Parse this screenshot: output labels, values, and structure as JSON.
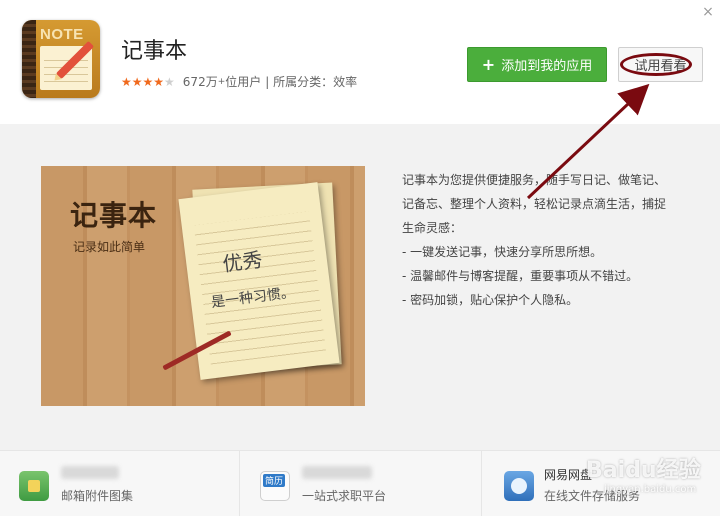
{
  "app": {
    "title": "记事本",
    "users_count": "672万",
    "users_plus": "+",
    "users_suffix": "位用户",
    "category": "| 所属分类：效率",
    "stars_on": "★★★★",
    "stars_off": "★",
    "icon_label": "NOTE"
  },
  "actions": {
    "add_label": "添加到我的应用",
    "try_label": "试用看看",
    "close": "×"
  },
  "screenshot": {
    "title": "记事本",
    "subtitle": "记录如此简单",
    "hand_line1": "优秀",
    "hand_line2": "是一种习惯。"
  },
  "description": [
    "记事本为您提供便捷服务，随手写日记、做笔记、",
    "记备忘、整理个人资料，轻松记录点滴生活，捕捉",
    "生命灵感：",
    "- 一键发送记事，快速分享所思所想。",
    "- 温馨邮件与博客提醒，重要事项从不错过。",
    "- 密码加锁，贴心保护个人隐私。"
  ],
  "footer": {
    "items": [
      {
        "name": "",
        "desc": "邮箱附件图集",
        "icon": "mail-attachment-icon"
      },
      {
        "name": "",
        "desc": "一站式求职平台",
        "icon": "resume-icon",
        "icon_text": "简历"
      },
      {
        "name": "网易网盘",
        "desc": "在线文件存储服务",
        "icon": "cloud-disk-icon"
      }
    ]
  },
  "watermark": {
    "brand": "Baidu经验",
    "url": "jingyan.baidu.com"
  },
  "colors": {
    "accent_green": "#4bae3c",
    "star_orange": "#f06a1e",
    "annotation_red": "#7a0a10"
  }
}
